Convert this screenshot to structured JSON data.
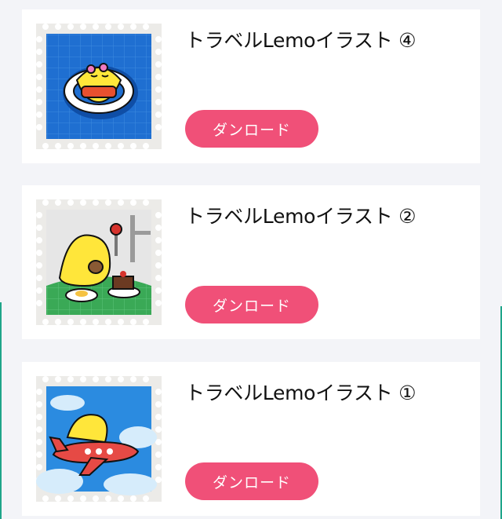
{
  "accent_color": "#f05078",
  "items": [
    {
      "title": "トラベルLemoイラスト ④",
      "button_label": "ダンロード",
      "image_icon": "lemo-swim-ring-icon"
    },
    {
      "title": "トラベルLemoイラスト ②",
      "button_label": "ダンロード",
      "image_icon": "lemo-breakfast-icon"
    },
    {
      "title": "トラベルLemoイラスト ①",
      "button_label": "ダンロード",
      "image_icon": "lemo-airplane-icon"
    }
  ]
}
